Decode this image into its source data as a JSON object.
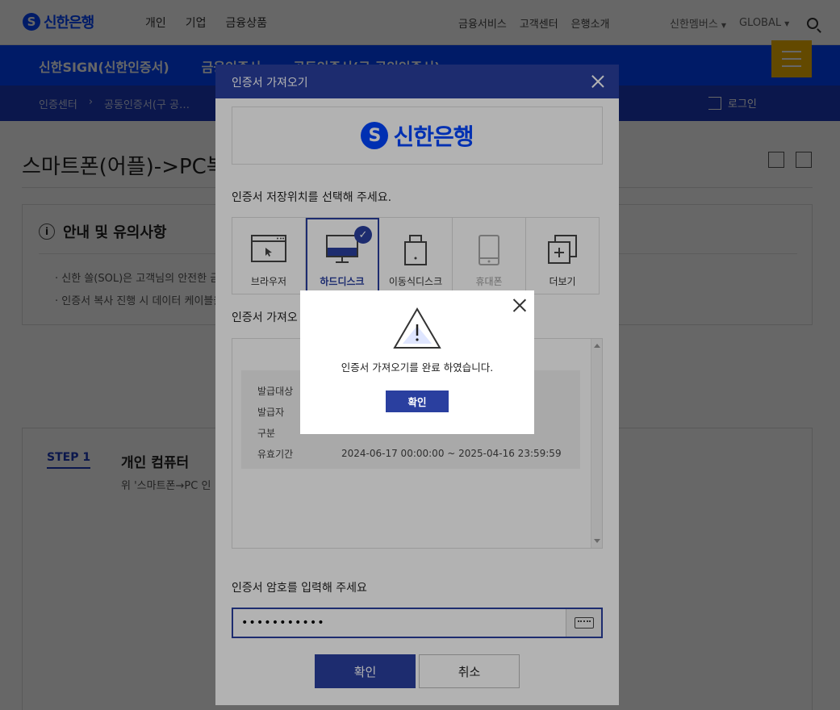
{
  "header": {
    "logo_text": "신한은행",
    "gnb": [
      "개인",
      "기업",
      "금융상품"
    ],
    "util": [
      "금융서비스",
      "고객센터",
      "은행소개"
    ],
    "util2": [
      "신한멤버스",
      "GLOBAL"
    ]
  },
  "subnav": {
    "items": [
      "신한SIGN(신한인증서)",
      "금융인증서",
      "공동인증서(구 공인인증서)"
    ]
  },
  "breadcrumb": {
    "items": [
      "인증센터",
      "공동인증서(구 공…"
    ],
    "login_label": "로그인"
  },
  "page": {
    "title": "스마트폰(어플)->PC복사"
  },
  "notice": {
    "title": "안내 및 유의사항",
    "items": [
      "신한 쏠(SOL)은 고객님의 안전한 금융거래를 위해",
      "인증서 복사 진행 시 데이터 케이블을"
    ]
  },
  "step": {
    "label": "STEP 1",
    "title": "개인 컴퓨터",
    "desc": "위 '스마트폰→PC 인"
  },
  "dialog": {
    "title": "인증서 가져오기",
    "bank_name": "신한은행",
    "location_prompt": "인증서 저장위치를 선택해 주세요.",
    "locations": [
      {
        "label": "브라우저",
        "icon": "browser-icon"
      },
      {
        "label": "하드디스크",
        "icon": "hard-disk-icon"
      },
      {
        "label": "이동식디스크",
        "icon": "removable-disk-icon"
      },
      {
        "label": "휴대폰",
        "icon": "phone-icon"
      },
      {
        "label": "더보기",
        "icon": "more-icon"
      }
    ],
    "selected_location": "하드디스크",
    "cert_section_label": "인증서 가져오",
    "cert_info": {
      "subject_label": "발급대상",
      "issuer_label": "발급자",
      "type_label": "구분",
      "validity_label": "유효기간",
      "validity_value": "2024-06-17 00:00:00 ~ 2025-04-16 23:59:59"
    },
    "password_prompt": "인증서 암호를 입력해 주세요",
    "password_value": "•••••••••••",
    "confirm_label": "확인",
    "cancel_label": "취소"
  },
  "alert": {
    "message": "인증서 가져오기를 완료 하였습니다.",
    "confirm_label": "확인"
  },
  "colors": {
    "brand_blue": "#0046ff",
    "dialog_blue": "#2a3f9f",
    "menu_yellow": "#f7b500"
  }
}
